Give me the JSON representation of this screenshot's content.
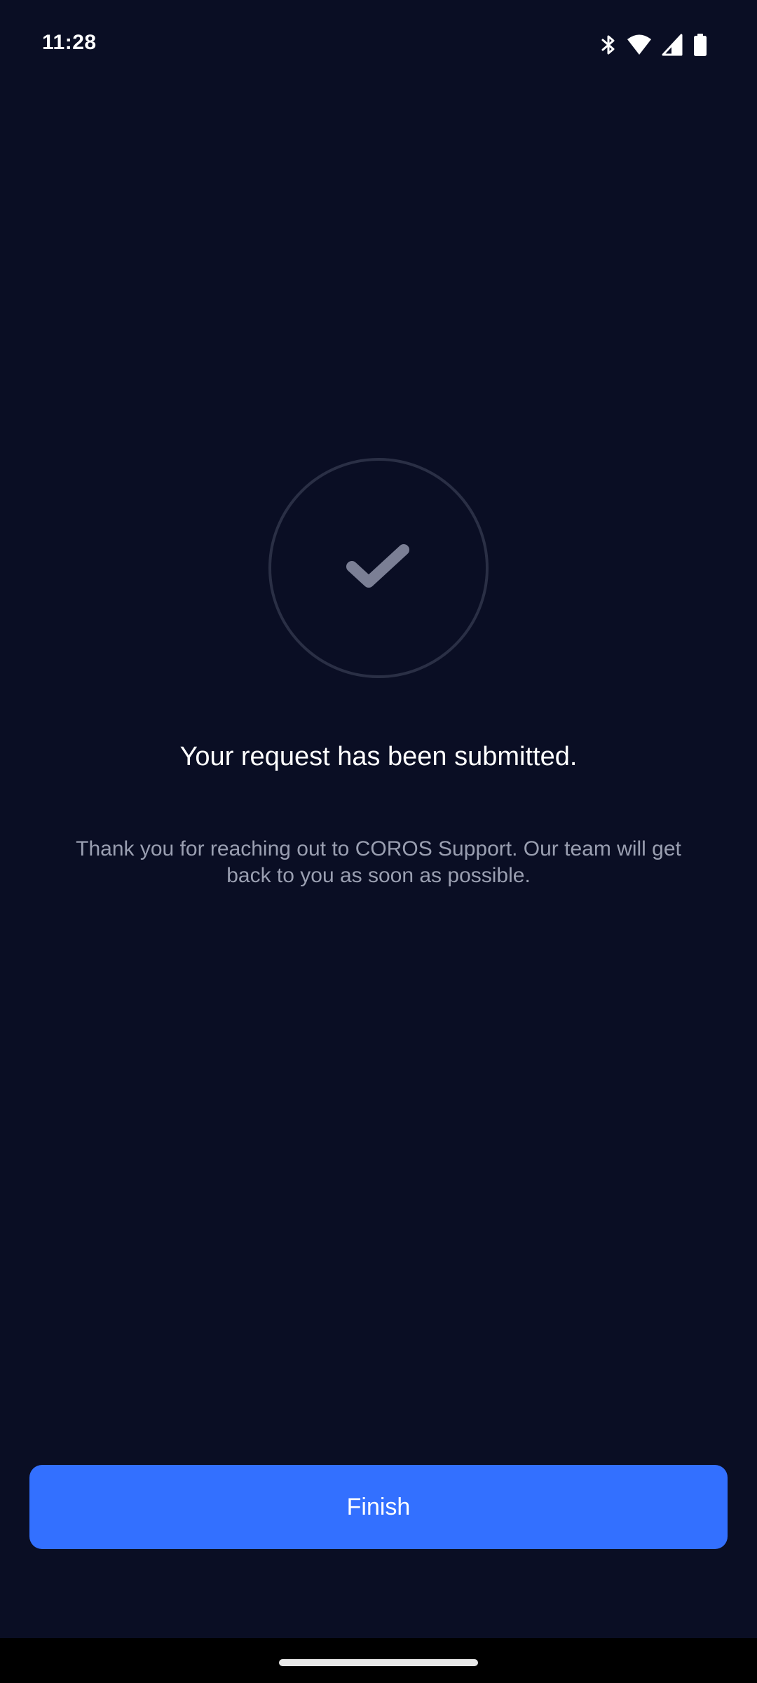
{
  "status_bar": {
    "time": "11:28",
    "icons": [
      "bluetooth-icon",
      "wifi-icon",
      "signal-icon",
      "battery-icon"
    ]
  },
  "success": {
    "icon": "checkmark-icon",
    "title": "Your request has been submitted.",
    "message": "Thank you for reaching out to COROS Support. Our team will get back to you as soon as possible."
  },
  "actions": {
    "finish_label": "Finish"
  },
  "colors": {
    "background": "#0a0e24",
    "accent": "#3370ff",
    "circle_border": "#2a2f45",
    "check": "#7b7f95",
    "message_text": "#9a9fb1"
  }
}
